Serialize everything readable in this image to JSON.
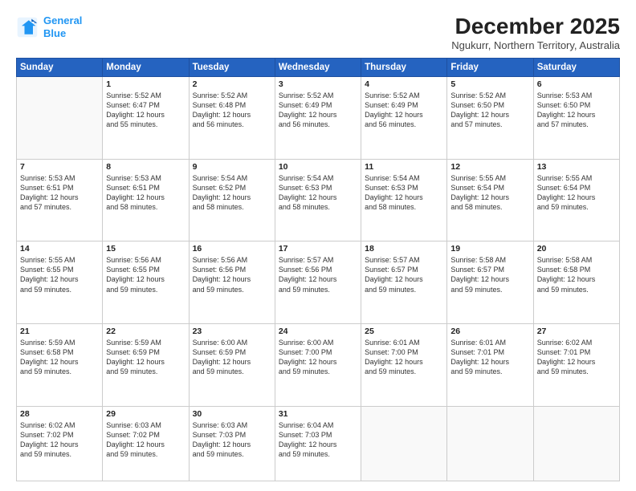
{
  "logo": {
    "line1": "General",
    "line2": "Blue"
  },
  "title": "December 2025",
  "subtitle": "Ngukurr, Northern Territory, Australia",
  "days_of_week": [
    "Sunday",
    "Monday",
    "Tuesday",
    "Wednesday",
    "Thursday",
    "Friday",
    "Saturday"
  ],
  "weeks": [
    [
      {
        "day": "",
        "info": ""
      },
      {
        "day": "1",
        "info": "Sunrise: 5:52 AM\nSunset: 6:47 PM\nDaylight: 12 hours\nand 55 minutes."
      },
      {
        "day": "2",
        "info": "Sunrise: 5:52 AM\nSunset: 6:48 PM\nDaylight: 12 hours\nand 56 minutes."
      },
      {
        "day": "3",
        "info": "Sunrise: 5:52 AM\nSunset: 6:49 PM\nDaylight: 12 hours\nand 56 minutes."
      },
      {
        "day": "4",
        "info": "Sunrise: 5:52 AM\nSunset: 6:49 PM\nDaylight: 12 hours\nand 56 minutes."
      },
      {
        "day": "5",
        "info": "Sunrise: 5:52 AM\nSunset: 6:50 PM\nDaylight: 12 hours\nand 57 minutes."
      },
      {
        "day": "6",
        "info": "Sunrise: 5:53 AM\nSunset: 6:50 PM\nDaylight: 12 hours\nand 57 minutes."
      }
    ],
    [
      {
        "day": "7",
        "info": "Sunrise: 5:53 AM\nSunset: 6:51 PM\nDaylight: 12 hours\nand 57 minutes."
      },
      {
        "day": "8",
        "info": "Sunrise: 5:53 AM\nSunset: 6:51 PM\nDaylight: 12 hours\nand 58 minutes."
      },
      {
        "day": "9",
        "info": "Sunrise: 5:54 AM\nSunset: 6:52 PM\nDaylight: 12 hours\nand 58 minutes."
      },
      {
        "day": "10",
        "info": "Sunrise: 5:54 AM\nSunset: 6:53 PM\nDaylight: 12 hours\nand 58 minutes."
      },
      {
        "day": "11",
        "info": "Sunrise: 5:54 AM\nSunset: 6:53 PM\nDaylight: 12 hours\nand 58 minutes."
      },
      {
        "day": "12",
        "info": "Sunrise: 5:55 AM\nSunset: 6:54 PM\nDaylight: 12 hours\nand 58 minutes."
      },
      {
        "day": "13",
        "info": "Sunrise: 5:55 AM\nSunset: 6:54 PM\nDaylight: 12 hours\nand 59 minutes."
      }
    ],
    [
      {
        "day": "14",
        "info": "Sunrise: 5:55 AM\nSunset: 6:55 PM\nDaylight: 12 hours\nand 59 minutes."
      },
      {
        "day": "15",
        "info": "Sunrise: 5:56 AM\nSunset: 6:55 PM\nDaylight: 12 hours\nand 59 minutes."
      },
      {
        "day": "16",
        "info": "Sunrise: 5:56 AM\nSunset: 6:56 PM\nDaylight: 12 hours\nand 59 minutes."
      },
      {
        "day": "17",
        "info": "Sunrise: 5:57 AM\nSunset: 6:56 PM\nDaylight: 12 hours\nand 59 minutes."
      },
      {
        "day": "18",
        "info": "Sunrise: 5:57 AM\nSunset: 6:57 PM\nDaylight: 12 hours\nand 59 minutes."
      },
      {
        "day": "19",
        "info": "Sunrise: 5:58 AM\nSunset: 6:57 PM\nDaylight: 12 hours\nand 59 minutes."
      },
      {
        "day": "20",
        "info": "Sunrise: 5:58 AM\nSunset: 6:58 PM\nDaylight: 12 hours\nand 59 minutes."
      }
    ],
    [
      {
        "day": "21",
        "info": "Sunrise: 5:59 AM\nSunset: 6:58 PM\nDaylight: 12 hours\nand 59 minutes."
      },
      {
        "day": "22",
        "info": "Sunrise: 5:59 AM\nSunset: 6:59 PM\nDaylight: 12 hours\nand 59 minutes."
      },
      {
        "day": "23",
        "info": "Sunrise: 6:00 AM\nSunset: 6:59 PM\nDaylight: 12 hours\nand 59 minutes."
      },
      {
        "day": "24",
        "info": "Sunrise: 6:00 AM\nSunset: 7:00 PM\nDaylight: 12 hours\nand 59 minutes."
      },
      {
        "day": "25",
        "info": "Sunrise: 6:01 AM\nSunset: 7:00 PM\nDaylight: 12 hours\nand 59 minutes."
      },
      {
        "day": "26",
        "info": "Sunrise: 6:01 AM\nSunset: 7:01 PM\nDaylight: 12 hours\nand 59 minutes."
      },
      {
        "day": "27",
        "info": "Sunrise: 6:02 AM\nSunset: 7:01 PM\nDaylight: 12 hours\nand 59 minutes."
      }
    ],
    [
      {
        "day": "28",
        "info": "Sunrise: 6:02 AM\nSunset: 7:02 PM\nDaylight: 12 hours\nand 59 minutes."
      },
      {
        "day": "29",
        "info": "Sunrise: 6:03 AM\nSunset: 7:02 PM\nDaylight: 12 hours\nand 59 minutes."
      },
      {
        "day": "30",
        "info": "Sunrise: 6:03 AM\nSunset: 7:03 PM\nDaylight: 12 hours\nand 59 minutes."
      },
      {
        "day": "31",
        "info": "Sunrise: 6:04 AM\nSunset: 7:03 PM\nDaylight: 12 hours\nand 59 minutes."
      },
      {
        "day": "",
        "info": ""
      },
      {
        "day": "",
        "info": ""
      },
      {
        "day": "",
        "info": ""
      }
    ]
  ]
}
